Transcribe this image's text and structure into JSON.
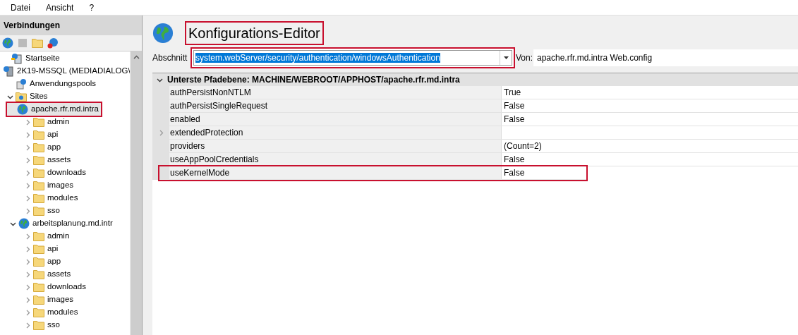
{
  "menu": [
    "Datei",
    "Ansicht",
    "?"
  ],
  "connections": {
    "title": "Verbindungen",
    "tree": [
      {
        "label": "Startseite",
        "kind": "home",
        "highlighted": false
      },
      {
        "label": "2K19-MSSQL (MEDIADIALOG\\",
        "kind": "server",
        "highlighted": false,
        "children": [
          {
            "label": "Anwendungspools",
            "kind": "apppool",
            "highlighted": false
          },
          {
            "label": "Sites",
            "kind": "sites",
            "expanded": true,
            "highlighted": false,
            "children": [
              {
                "label": "apache.rfr.md.intra",
                "kind": "site",
                "expanded": true,
                "highlighted": true,
                "children": [
                  {
                    "label": "admin",
                    "kind": "folder",
                    "expanded": false,
                    "highlighted": false
                  },
                  {
                    "label": "api",
                    "kind": "folder",
                    "expanded": false,
                    "highlighted": false
                  },
                  {
                    "label": "app",
                    "kind": "folder",
                    "expanded": false,
                    "highlighted": false
                  },
                  {
                    "label": "assets",
                    "kind": "folder",
                    "expanded": false,
                    "highlighted": false
                  },
                  {
                    "label": "downloads",
                    "kind": "folder",
                    "expanded": false,
                    "highlighted": false
                  },
                  {
                    "label": "images",
                    "kind": "folder",
                    "expanded": false,
                    "highlighted": false
                  },
                  {
                    "label": "modules",
                    "kind": "folder",
                    "expanded": false,
                    "highlighted": false
                  },
                  {
                    "label": "sso",
                    "kind": "folder",
                    "expanded": false,
                    "highlighted": false
                  }
                ]
              },
              {
                "label": "arbeitsplanung.md.intr",
                "kind": "site",
                "expanded": true,
                "highlighted": false,
                "children": [
                  {
                    "label": "admin",
                    "kind": "folder",
                    "expanded": false,
                    "highlighted": false
                  },
                  {
                    "label": "api",
                    "kind": "folder",
                    "expanded": false,
                    "highlighted": false
                  },
                  {
                    "label": "app",
                    "kind": "folder",
                    "expanded": false,
                    "highlighted": false
                  },
                  {
                    "label": "assets",
                    "kind": "folder",
                    "expanded": false,
                    "highlighted": false
                  },
                  {
                    "label": "downloads",
                    "kind": "folder",
                    "expanded": false,
                    "highlighted": false
                  },
                  {
                    "label": "images",
                    "kind": "folder",
                    "expanded": false,
                    "highlighted": false
                  },
                  {
                    "label": "modules",
                    "kind": "folder",
                    "expanded": false,
                    "highlighted": false
                  },
                  {
                    "label": "sso",
                    "kind": "folder",
                    "expanded": false,
                    "highlighted": false
                  }
                ]
              }
            ]
          }
        ]
      }
    ]
  },
  "editor": {
    "title": "Konfigurations-Editor",
    "title_highlighted": true,
    "section_label": "Abschnitt",
    "section_value": "system.webServer/security/authentication/windowsAuthentication",
    "section_highlighted": true,
    "from_label": "Von:",
    "from_value": "apache.rfr.md.intra Web.config",
    "group": {
      "label": "Unterste Pfadebene: MACHINE/WEBROOT/APPHOST/apache.rfr.md.intra",
      "expanded": true
    },
    "rows": [
      {
        "name": "authPersistNonNTLM",
        "value": "True",
        "expandable": false,
        "highlighted": false
      },
      {
        "name": "authPersistSingleRequest",
        "value": "False",
        "expandable": false,
        "highlighted": false
      },
      {
        "name": "enabled",
        "value": "False",
        "expandable": false,
        "highlighted": false
      },
      {
        "name": "extendedProtection",
        "value": "",
        "expandable": true,
        "highlighted": false
      },
      {
        "name": "providers",
        "value": "(Count=2)",
        "expandable": false,
        "highlighted": false
      },
      {
        "name": "useAppPoolCredentials",
        "value": "False",
        "expandable": false,
        "highlighted": false
      },
      {
        "name": "useKernelMode",
        "value": "False",
        "expandable": false,
        "highlighted": true
      }
    ]
  }
}
